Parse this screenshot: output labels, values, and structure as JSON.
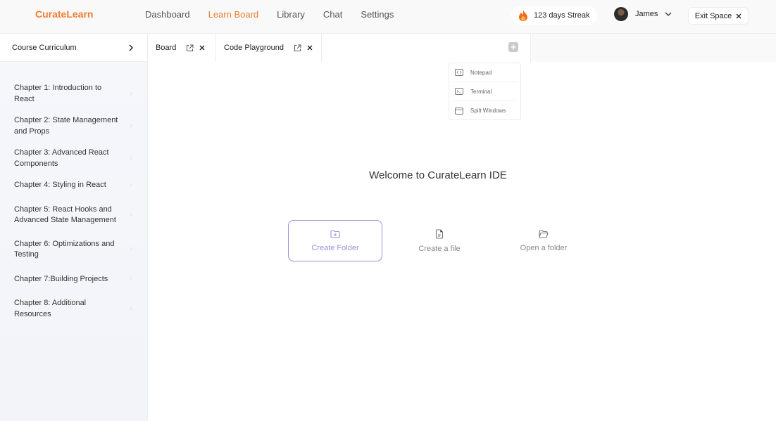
{
  "app": {
    "logo": "CurateLearn"
  },
  "nav": {
    "items": [
      {
        "label": "Dashboard",
        "active": false
      },
      {
        "label": "Learn Board",
        "active": true
      },
      {
        "label": "Library",
        "active": false
      },
      {
        "label": "Chat",
        "active": false
      },
      {
        "label": "Settings",
        "active": false
      }
    ]
  },
  "streak": {
    "label": "123 days Streak",
    "icon": "fire-icon"
  },
  "user": {
    "name": "James"
  },
  "exit": {
    "label": "Exit Space"
  },
  "sidebar": {
    "title": "Course Curriculum",
    "chapters": [
      {
        "label": "Chapter 1: Introduction to React"
      },
      {
        "label": "Chapter  2: State Management and Props"
      },
      {
        "label": "Chapter 3: Advanced React Components"
      },
      {
        "label": "Chapter  4: Styling in React"
      },
      {
        "label": "Chapter 5: React Hooks and Advanced State Management"
      },
      {
        "label": "Chapter 6: Optimizations and Testing"
      },
      {
        "label": "Chapter  7:Building Projects"
      },
      {
        "label": "Chapter 8: Additional Resources"
      }
    ]
  },
  "tabs": [
    {
      "label": "Board"
    },
    {
      "label": "Code Playground"
    }
  ],
  "menu": {
    "items": [
      {
        "label": "Notepad",
        "icon": "code-icon"
      },
      {
        "label": "Terminal",
        "icon": "terminal-icon"
      },
      {
        "label": "Spilt Windows",
        "icon": "window-icon"
      }
    ]
  },
  "main": {
    "welcome": "Welcome to CurateLearn IDE",
    "actions": [
      {
        "label": "Create Folder",
        "icon": "folder-plus-icon"
      },
      {
        "label": "Create a file",
        "icon": "file-icon"
      },
      {
        "label": "Open a folder",
        "icon": "folder-open-icon"
      }
    ]
  },
  "colors": {
    "accent": "#f07b2d",
    "primary_action": "#9b8fd9"
  }
}
